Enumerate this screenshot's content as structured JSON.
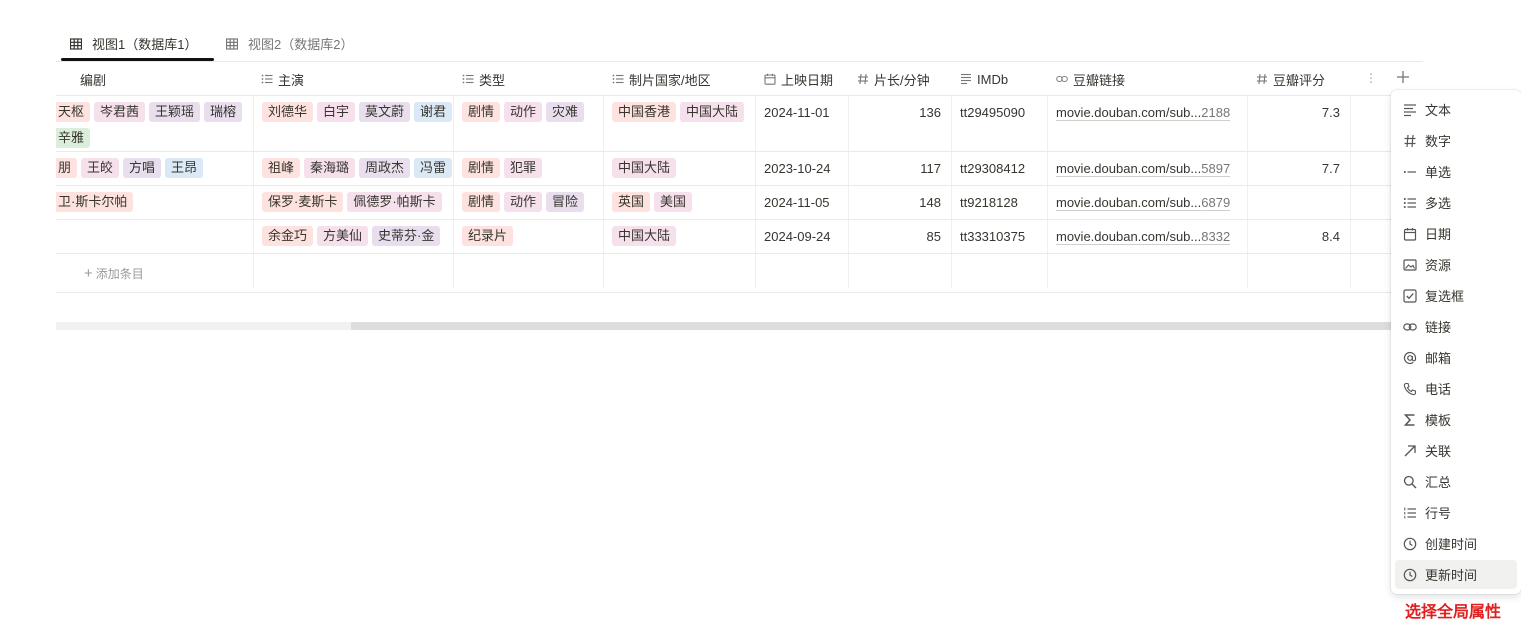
{
  "tabs": [
    {
      "label": "视图1（数据库1）",
      "active": true
    },
    {
      "label": "视图2（数据库2）",
      "active": false
    }
  ],
  "columns": [
    {
      "label": "编剧",
      "icon": "none"
    },
    {
      "label": "主演",
      "icon": "multi-select-icon"
    },
    {
      "label": "类型",
      "icon": "multi-select-icon"
    },
    {
      "label": "制片国家/地区",
      "icon": "multi-select-icon"
    },
    {
      "label": "上映日期",
      "icon": "calendar-icon"
    },
    {
      "label": "片长/分钟",
      "icon": "number-icon"
    },
    {
      "label": "IMDb",
      "icon": "text-icon"
    },
    {
      "label": "豆瓣链接",
      "icon": "link-icon"
    },
    {
      "label": "豆瓣评分",
      "icon": "number-icon"
    }
  ],
  "rows": [
    {
      "writers": [
        "天枢",
        "岑君茜",
        "王颖瑶",
        "瑞榕",
        "辛雅"
      ],
      "cast": [
        "刘德华",
        "白宇",
        "莫文蔚",
        "谢君"
      ],
      "genres": [
        "剧情",
        "动作",
        "灾难"
      ],
      "countries": [
        "中国香港",
        "中国大陆"
      ],
      "date": "2024-11-01",
      "length": "136",
      "imdb": "tt29495090",
      "douban_prefix": "movie.douban.com/sub...",
      "douban_suffix": "2188",
      "rating": "7.3"
    },
    {
      "writers": [
        "朋",
        "王皎",
        "方唱",
        "王昂"
      ],
      "cast": [
        "祖峰",
        "秦海璐",
        "周政杰",
        "冯雷"
      ],
      "genres": [
        "剧情",
        "犯罪"
      ],
      "countries": [
        "中国大陆"
      ],
      "date": "2023-10-24",
      "length": "117",
      "imdb": "tt29308412",
      "douban_prefix": "movie.douban.com/sub...",
      "douban_suffix": "5897",
      "rating": "7.7"
    },
    {
      "writers": [
        "卫·斯卡尔帕"
      ],
      "cast": [
        "保罗·麦斯卡",
        "佩德罗·帕斯卡"
      ],
      "genres": [
        "剧情",
        "动作",
        "冒险"
      ],
      "countries": [
        "英国",
        "美国"
      ],
      "date": "2024-11-05",
      "length": "148",
      "imdb": "tt9218128",
      "douban_prefix": "movie.douban.com/sub...",
      "douban_suffix": "6879",
      "rating": ""
    },
    {
      "writers": [],
      "cast": [
        "余金巧",
        "方美仙",
        "史蒂芬·金"
      ],
      "genres": [
        "纪录片"
      ],
      "countries": [
        "中国大陆"
      ],
      "date": "2024-09-24",
      "length": "85",
      "imdb": "tt33310375",
      "douban_prefix": "movie.douban.com/sub...",
      "douban_suffix": "8332",
      "rating": "8.4"
    }
  ],
  "add_row_label": "添加条目",
  "property_menu": [
    {
      "label": "文本",
      "icon": "text-icon"
    },
    {
      "label": "数字",
      "icon": "number-icon"
    },
    {
      "label": "单选",
      "icon": "single-select-icon"
    },
    {
      "label": "多选",
      "icon": "multi-select-icon"
    },
    {
      "label": "日期",
      "icon": "calendar-icon"
    },
    {
      "label": "资源",
      "icon": "image-icon"
    },
    {
      "label": "复选框",
      "icon": "checkbox-icon"
    },
    {
      "label": "链接",
      "icon": "link-icon"
    },
    {
      "label": "邮箱",
      "icon": "at-icon"
    },
    {
      "label": "电话",
      "icon": "phone-icon"
    },
    {
      "label": "模板",
      "icon": "sigma-icon"
    },
    {
      "label": "关联",
      "icon": "arrow-up-right-icon"
    },
    {
      "label": "汇总",
      "icon": "search-icon"
    },
    {
      "label": "行号",
      "icon": "numbered-list-icon"
    },
    {
      "label": "创建时间",
      "icon": "clock-icon"
    },
    {
      "label": "更新时间",
      "icon": "clock-icon"
    }
  ],
  "annotation": "选择全局属性",
  "colors": {
    "annotation": "#e02020",
    "tag_red": "#fde2df",
    "tag_pink": "#f5e0ec",
    "tag_purple": "#e8deee",
    "tag_blue": "#dbe8f5",
    "tag_green": "#dbeddb"
  }
}
